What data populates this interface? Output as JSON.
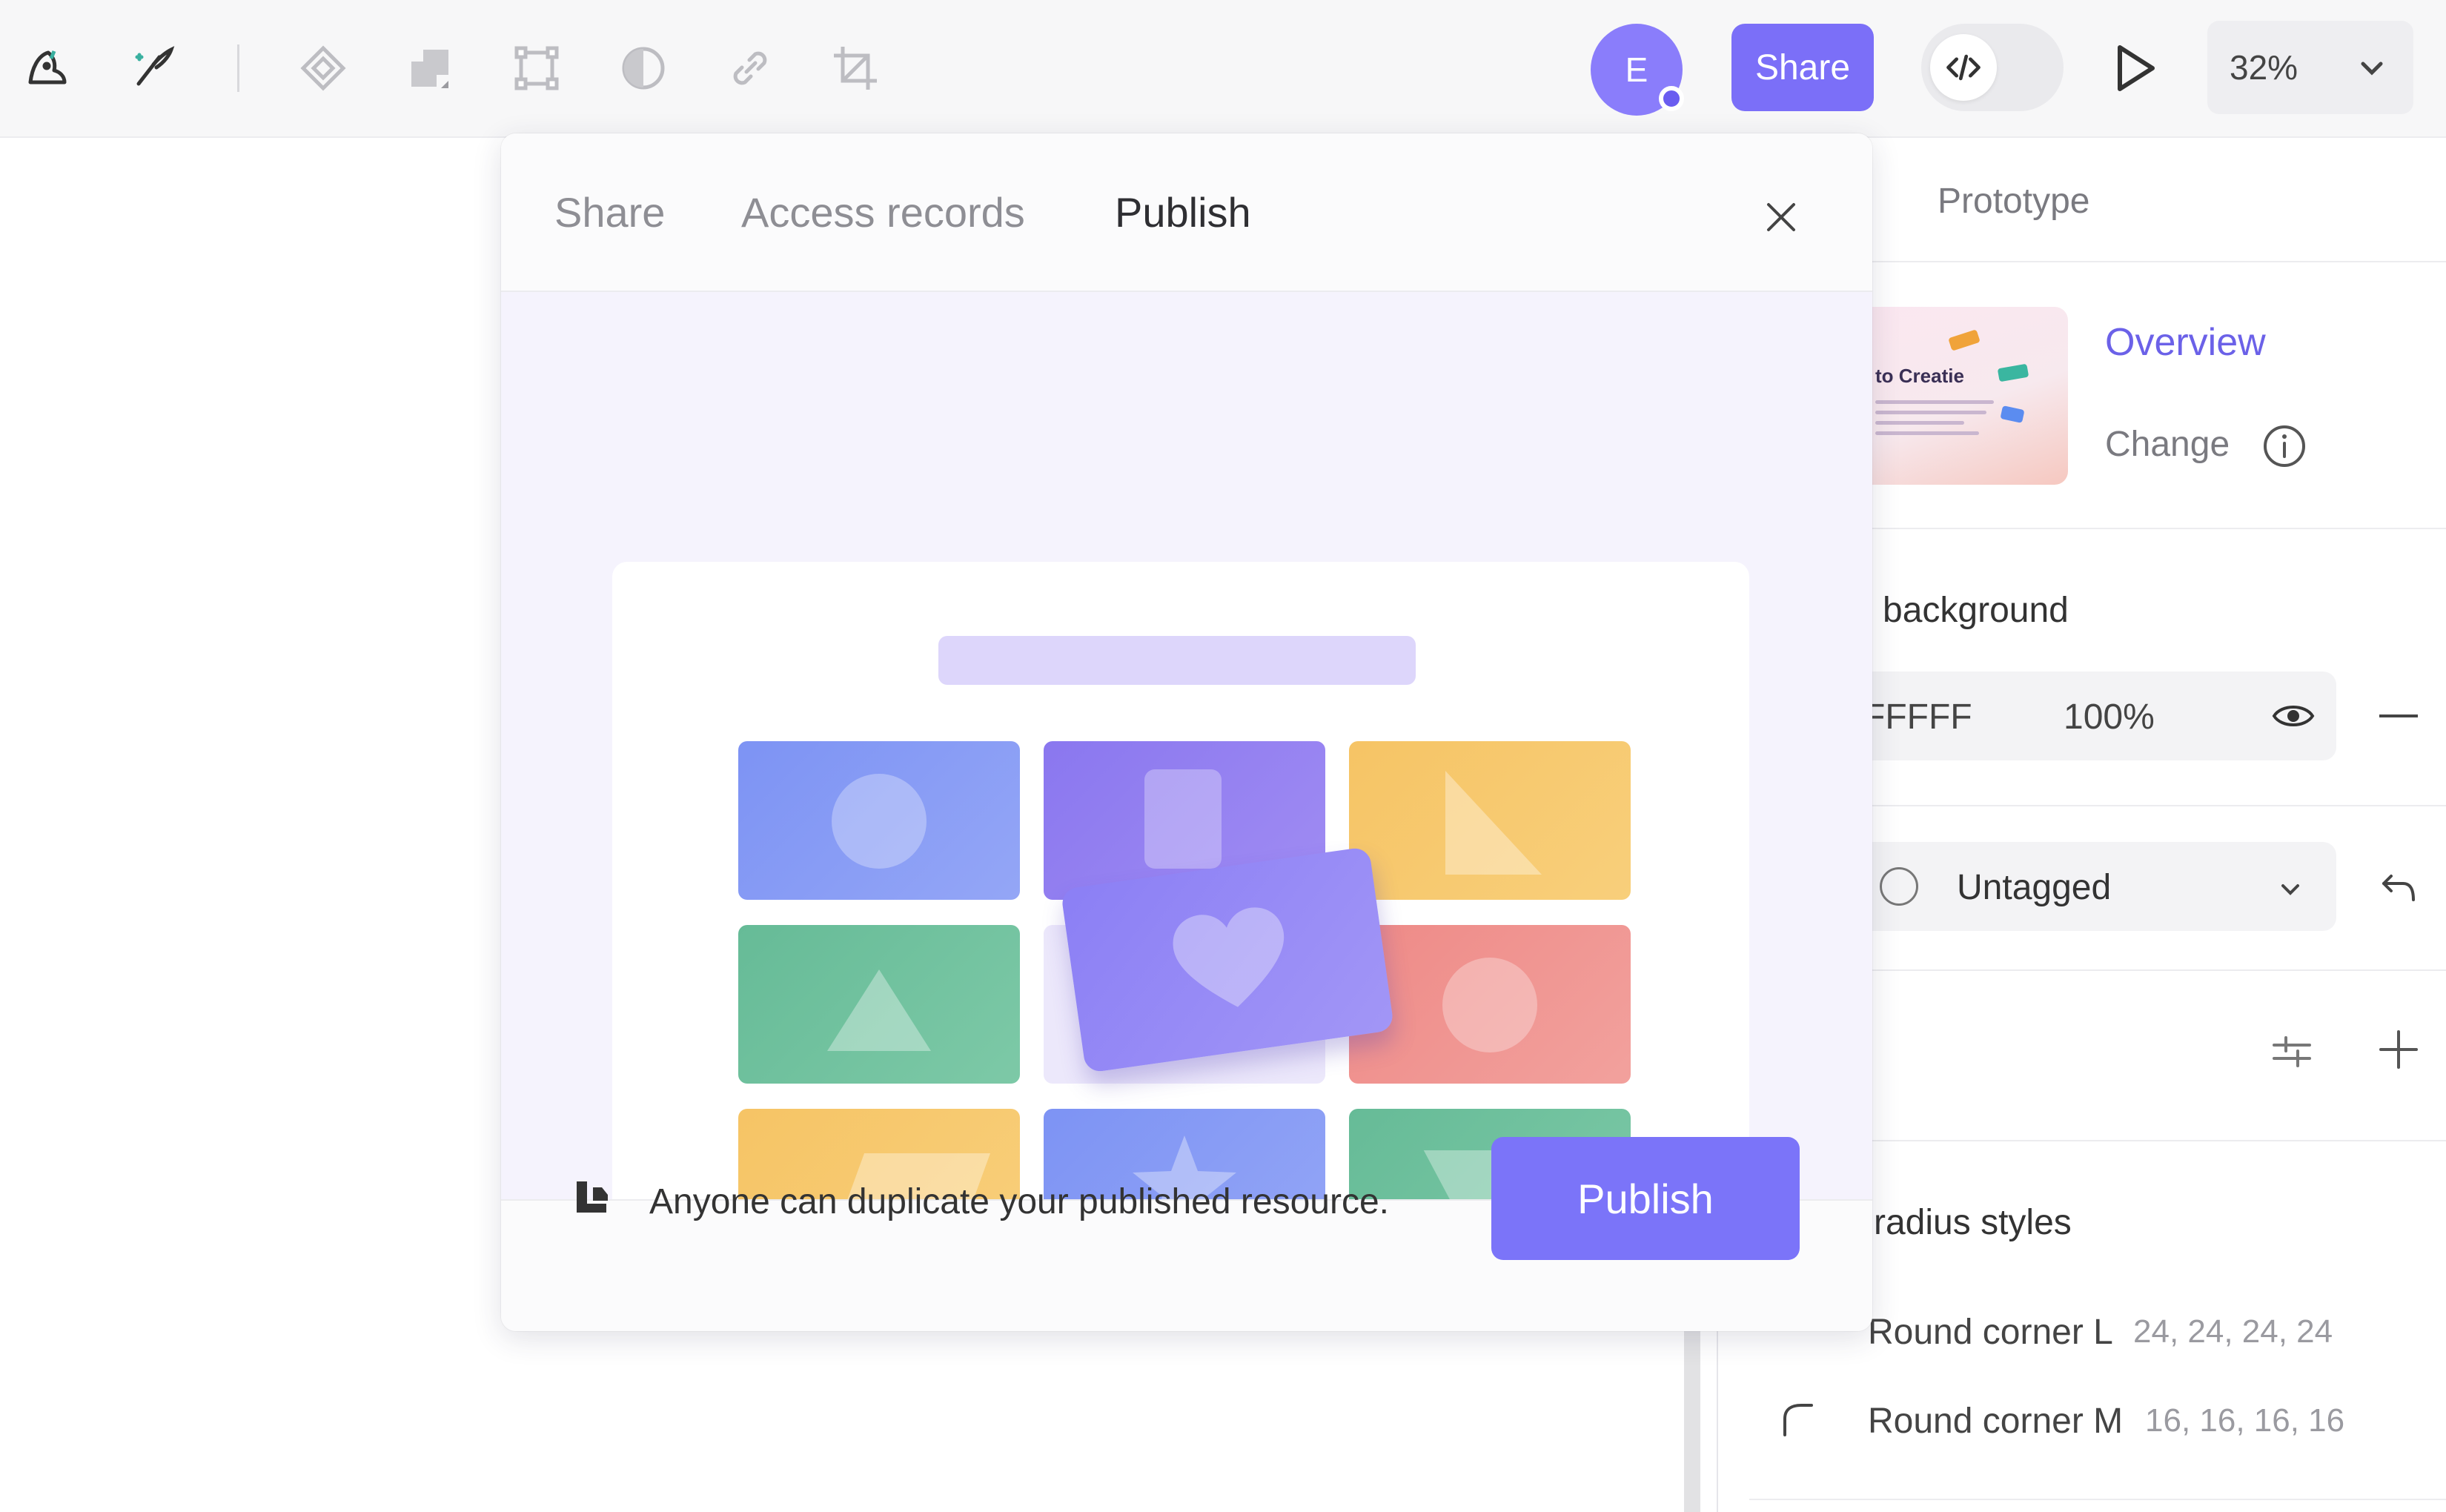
{
  "toolbar": {
    "tools": [
      "logo-icon",
      "brush-icon",
      "component-icon",
      "boolean-icon",
      "frame-icon",
      "mask-icon",
      "link-icon",
      "crop-icon"
    ],
    "avatar_initial": "E",
    "share_label": "Share",
    "zoom": "32%"
  },
  "modal": {
    "tabs": [
      {
        "label": "Share",
        "active": false
      },
      {
        "label": "Access records",
        "active": false
      },
      {
        "label": "Publish",
        "active": true
      }
    ],
    "notice": "Anyone can duplicate your published resource.",
    "publish_label": "Publish",
    "accent": "#7b74f9"
  },
  "right_panel": {
    "tab_prototype": "Prototype",
    "thumbnail_title": "to Creatie",
    "overview_label": "Overview",
    "change_label": "Change",
    "background_label": "background",
    "fill_hex": "FFFFF",
    "fill_opacity": "100%",
    "tag_label": "Untagged",
    "radius_label": "radius styles",
    "radius_styles": [
      {
        "name": "Round corner L",
        "value": "24, 24, 24, 24"
      },
      {
        "name": "Round corner M",
        "value": "16, 16, 16, 16"
      }
    ]
  }
}
